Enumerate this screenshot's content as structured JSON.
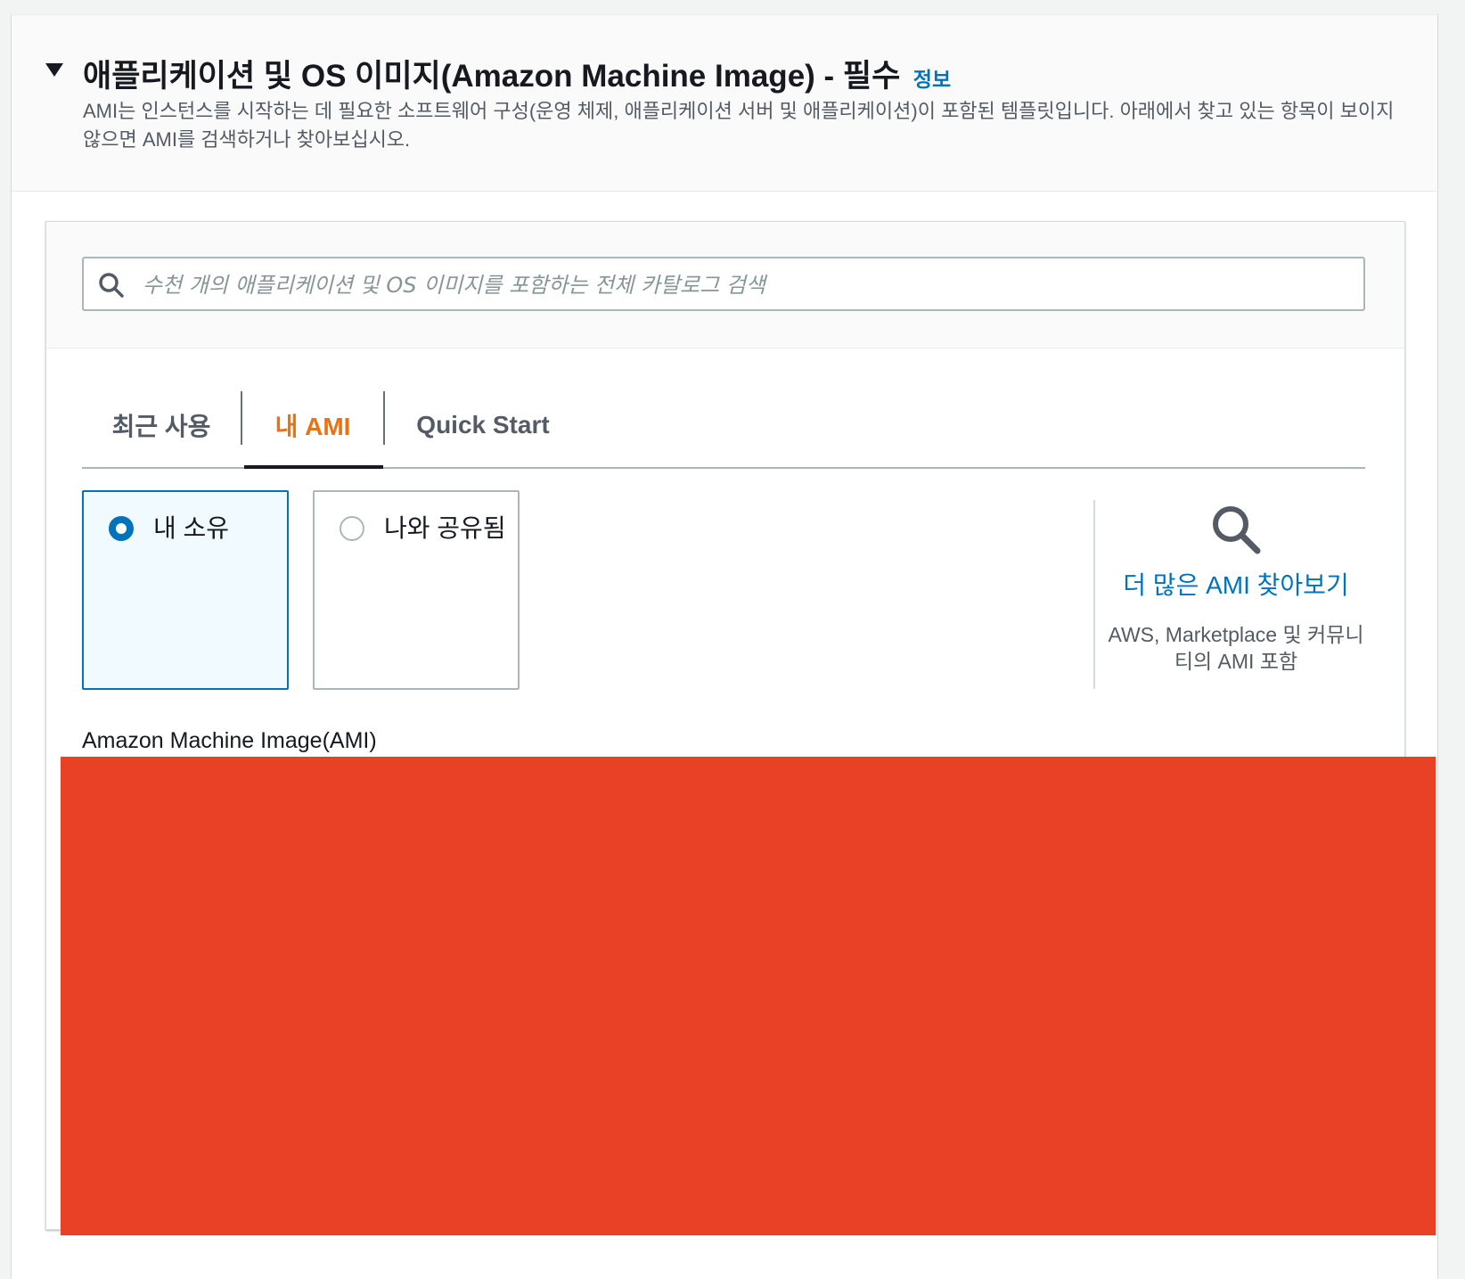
{
  "section": {
    "title": "애플리케이션 및 OS 이미지(Amazon Machine Image) - 필수",
    "info_link": "정보",
    "description": "AMI는 인스턴스를 시작하는 데 필요한 소프트웨어 구성(운영 체제, 애플리케이션 서버 및 애플리케이션)이 포함된 템플릿입니다. 아래에서 찾고 있는 항목이 보이지 않으면 AMI를 검색하거나 찾아보십시오."
  },
  "search": {
    "placeholder": "수천 개의 애플리케이션 및 OS 이미지를 포함하는 전체 카탈로그 검색",
    "value": "",
    "icon": "search-icon"
  },
  "tabs": [
    {
      "label": "최근 사용",
      "active": false
    },
    {
      "label": "내 AMI",
      "active": true
    },
    {
      "label": "Quick Start",
      "active": false
    }
  ],
  "ownership_options": [
    {
      "label": "내 소유",
      "selected": true
    },
    {
      "label": "나와 공유됨",
      "selected": false
    }
  ],
  "browse_more": {
    "link": "더 많은 AMI 찾아보기",
    "description": "AWS, Marketplace 및 커뮤니티의 AMI 포함",
    "icon": "search-icon"
  },
  "ami_field": {
    "label": "Amazon Machine Image(AMI)"
  },
  "colors": {
    "link": "#0073bb",
    "active_tab": "#ec7211",
    "selected_tile_bg": "#f1faff",
    "redaction": "#e84125"
  }
}
